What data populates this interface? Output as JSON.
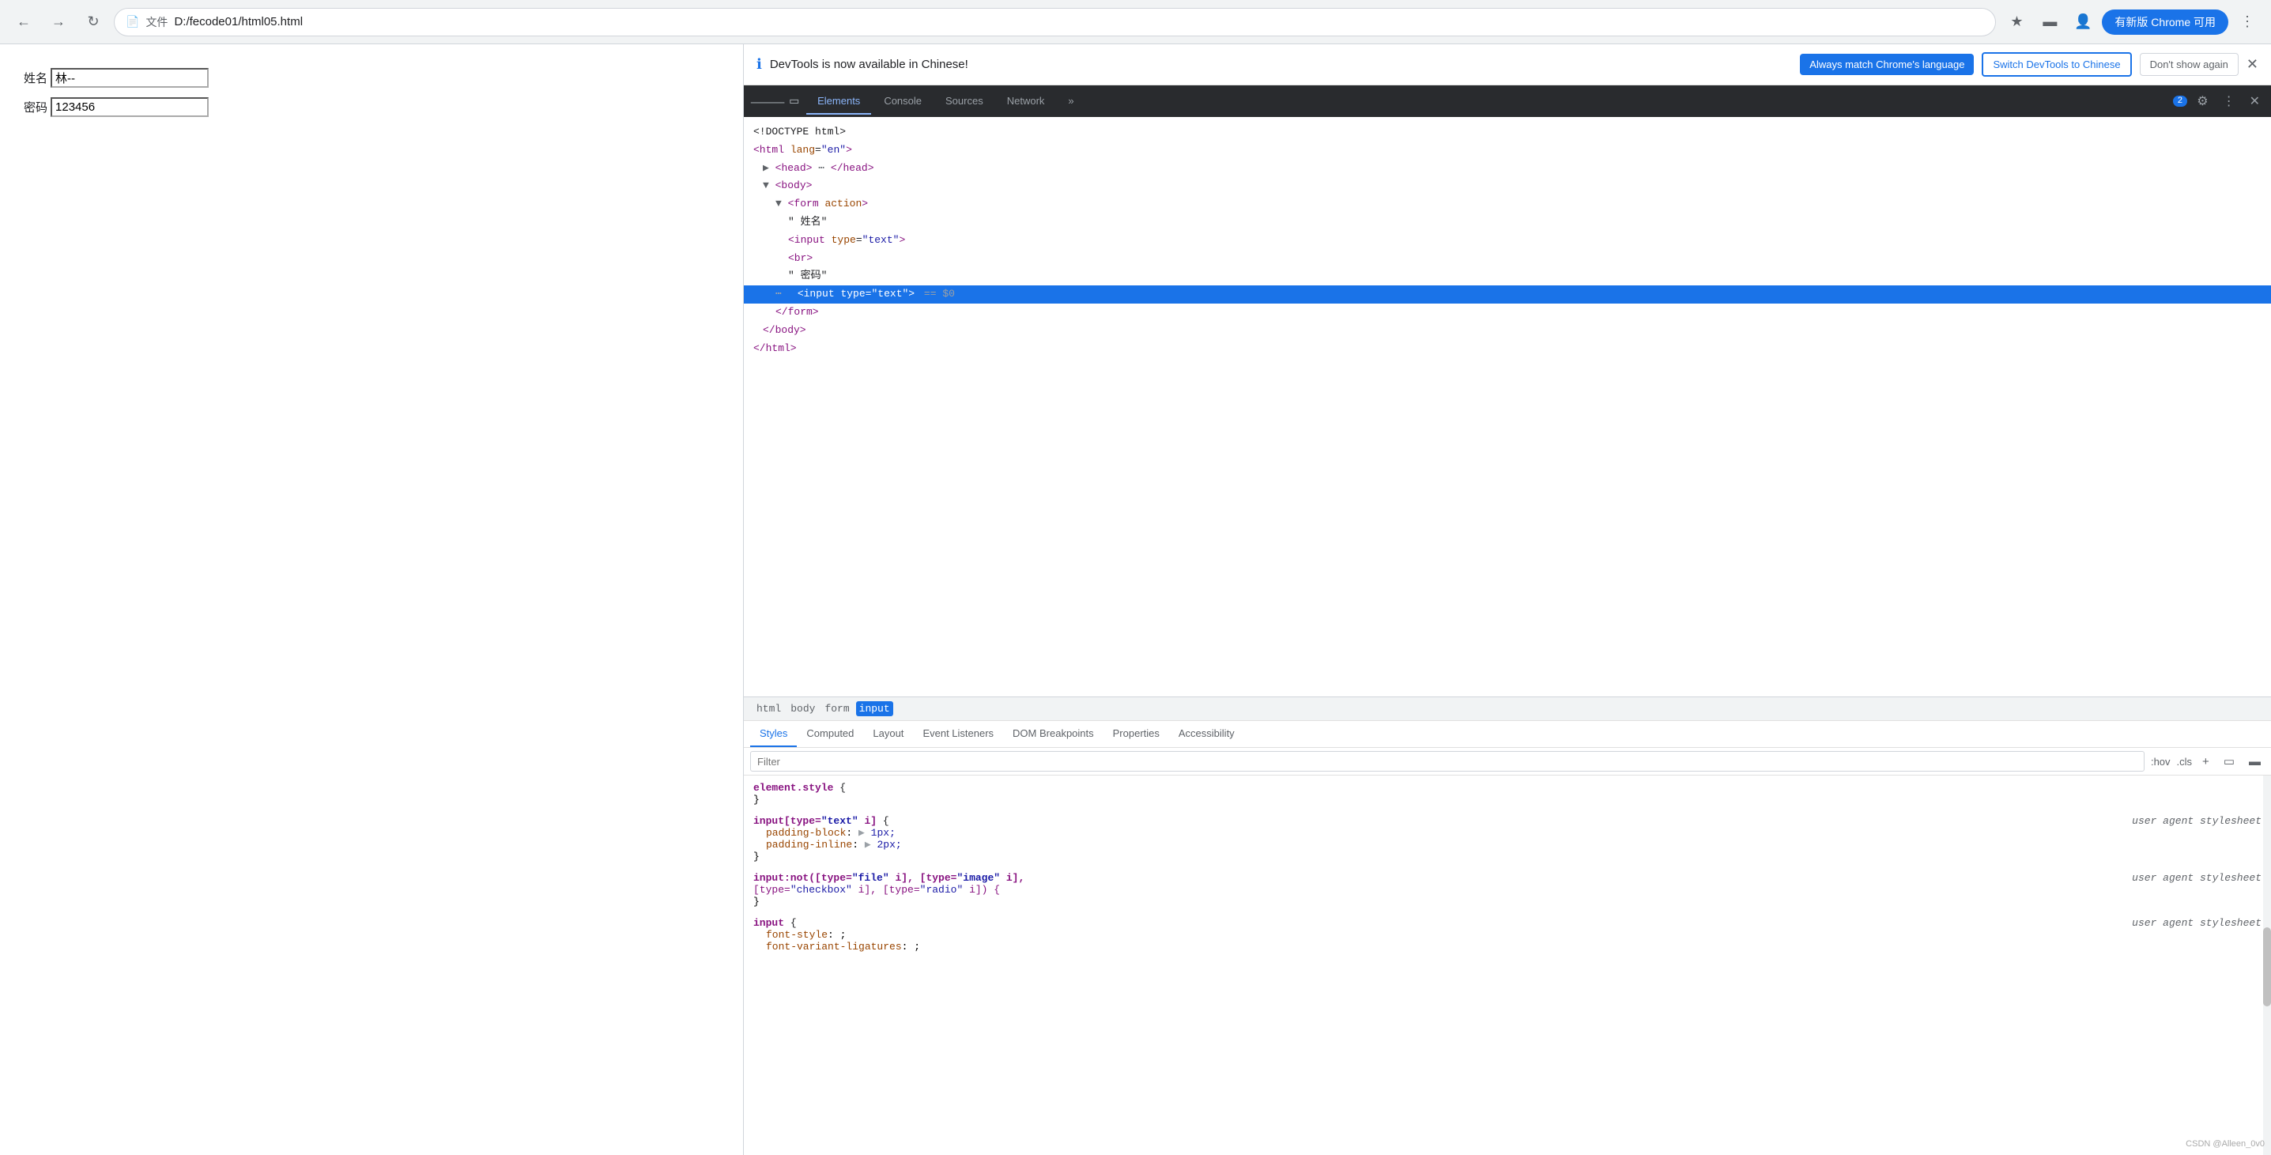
{
  "browser": {
    "url": "D:/fecode01/html05.html",
    "file_label": "文件",
    "update_btn": "有新版 Chrome 可用"
  },
  "page": {
    "name_label": "姓名",
    "name_value": "林--",
    "password_label": "密码",
    "password_value": "123456"
  },
  "devtools": {
    "notification": {
      "icon": "ℹ",
      "text": "DevTools is now available in Chinese!",
      "btn1": "Always match Chrome's language",
      "btn2": "Switch DevTools to Chinese",
      "btn3": "Don't show again"
    },
    "tabs": [
      "Elements",
      "Console",
      "Sources",
      "Network",
      "»"
    ],
    "active_tab": "Elements",
    "badge": "2",
    "html_tree": [
      {
        "indent": 0,
        "content": "<!DOCTYPE html>",
        "selected": false
      },
      {
        "indent": 0,
        "content": "<html lang=\"en\">",
        "selected": false
      },
      {
        "indent": 1,
        "content": "▶ <head> ⋯ </head>",
        "selected": false
      },
      {
        "indent": 1,
        "content": "▼ <body>",
        "selected": false
      },
      {
        "indent": 2,
        "content": "▼ <form action>",
        "selected": false
      },
      {
        "indent": 3,
        "content": "\" 姓名\"",
        "selected": false
      },
      {
        "indent": 3,
        "content": "<input type=\"text\">",
        "selected": false
      },
      {
        "indent": 3,
        "content": "<br>",
        "selected": false
      },
      {
        "indent": 3,
        "content": "\" 密码\"",
        "selected": false
      },
      {
        "indent": 3,
        "content": "<input type=\"text\"> == $0",
        "selected": true
      },
      {
        "indent": 2,
        "content": "</form>",
        "selected": false
      },
      {
        "indent": 1,
        "content": "</body>",
        "selected": false
      },
      {
        "indent": 0,
        "content": "</html>",
        "selected": false
      }
    ],
    "breadcrumbs": [
      "html",
      "body",
      "form",
      "input"
    ],
    "active_breadcrumb": "input",
    "styles_tabs": [
      "Styles",
      "Computed",
      "Layout",
      "Event Listeners",
      "DOM Breakpoints",
      "Properties",
      "Accessibility"
    ],
    "active_styles_tab": "Styles",
    "filter_placeholder": "Filter",
    "filter_value": "",
    "pseudo_states": ":hov  .cls",
    "styles": [
      {
        "selector": "element.style {",
        "closing": "}",
        "props": [],
        "source": ""
      },
      {
        "selector": "input[type=\"text\" i] {",
        "closing": "}",
        "props": [
          {
            "name": "padding-block",
            "value": "▶ 1px;"
          },
          {
            "name": "padding-inline",
            "value": "▶ 2px;"
          }
        ],
        "source": "user agent stylesheet"
      },
      {
        "selector": "input:not([type=\"file\" i], [type=\"image\" i],",
        "selector2": "[type=\"checkbox\" i], [type=\"radio\" i]) {",
        "closing": "}",
        "props": [],
        "source": "user agent stylesheet"
      },
      {
        "selector": "input {",
        "closing": "}",
        "props": [
          {
            "name": "font-style",
            "value": ";"
          },
          {
            "name": "font-variant-ligatures",
            "value": ";"
          }
        ],
        "source": "user agent stylesheet"
      }
    ]
  }
}
